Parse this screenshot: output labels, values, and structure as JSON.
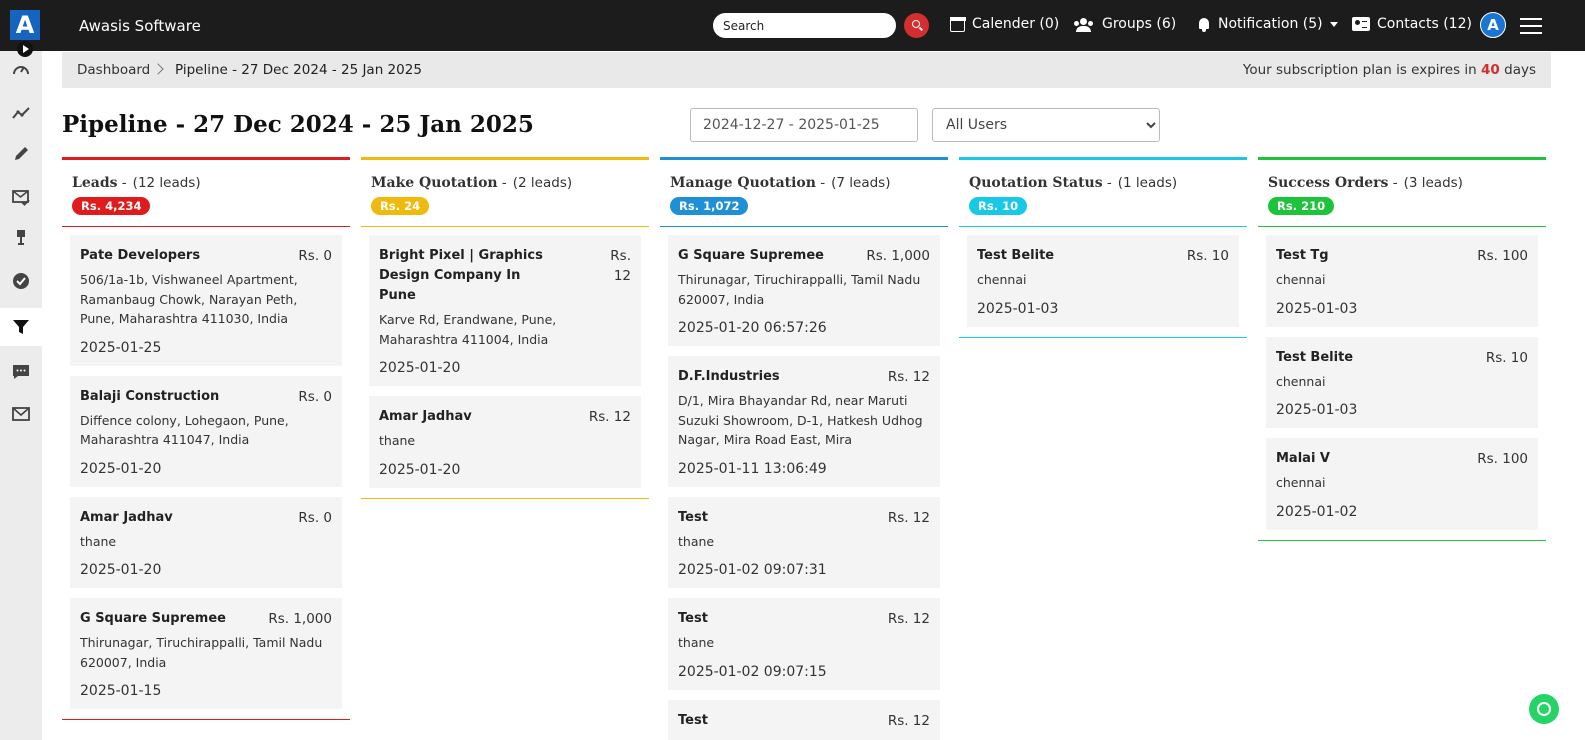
{
  "app": {
    "logo_letter": "A",
    "brand": "Awasis Software"
  },
  "search": {
    "placeholder": "Search"
  },
  "nav": {
    "calendar": "Calender (0)",
    "groups": "Groups (6)",
    "notification": "Notification (5)",
    "contacts": "Contacts (12)",
    "avatar_letter": "A"
  },
  "sidebar": {
    "items": [
      {
        "name": "dashboard",
        "icon": "speedometer-icon"
      },
      {
        "name": "analytics",
        "icon": "chart-line-icon"
      },
      {
        "name": "edit",
        "icon": "pencil-icon"
      },
      {
        "name": "mail-check",
        "icon": "mail-check-icon"
      },
      {
        "name": "award",
        "icon": "award-icon"
      },
      {
        "name": "tasks",
        "icon": "check-circle-icon"
      },
      {
        "name": "pipeline",
        "icon": "funnel-icon",
        "active": true
      },
      {
        "name": "chat",
        "icon": "chat-icon"
      },
      {
        "name": "mail",
        "icon": "envelope-icon"
      }
    ]
  },
  "breadcrumb": {
    "home": "Dashboard",
    "current": "Pipeline - 27 Dec 2024 - 25 Jan 2025"
  },
  "subscription": {
    "prefix": "Your subscription plan is expires in",
    "days": "40",
    "suffix": "days"
  },
  "page": {
    "title": "Pipeline - 27 Dec 2024 - 25 Jan 2025"
  },
  "filters": {
    "date_range": "2024-12-27 - 2025-01-25",
    "user": "All Users"
  },
  "columns": [
    {
      "title": "Leads",
      "count": "(12 leads)",
      "total": "Rs. 4,234",
      "color": "#e01b1b",
      "cards": [
        {
          "name": "Pate Developers",
          "amount": "Rs. 0",
          "address": "506/1a-1b, Vishwaneel Apartment, Ramanbaug Chowk, Narayan Peth, Pune, Maharashtra 411030, India",
          "date": "2025-01-25"
        },
        {
          "name": "Balaji Construction",
          "amount": "Rs. 0",
          "address": "Diffence colony, Lohegaon, Pune, Maharashtra 411047, India",
          "date": "2025-01-20"
        },
        {
          "name": "Amar Jadhav",
          "amount": "Rs. 0",
          "address": "thane",
          "date": "2025-01-20"
        },
        {
          "name": "G Square Supremee",
          "amount": "Rs. 1,000",
          "address": "Thirunagar, Tiruchirappalli, Tamil Nadu 620007, India",
          "date": "2025-01-15"
        }
      ]
    },
    {
      "title": "Make Quotation",
      "count": "(2 leads)",
      "total": "Rs. 24",
      "color": "#f0b90e",
      "cards": [
        {
          "name": "Bright Pixel | Graphics Design Company In Pune",
          "amount": "Rs. 12",
          "address": "Karve Rd, Erandwane, Pune, Maharashtra 411004, India",
          "date": "2025-01-20"
        },
        {
          "name": "Amar Jadhav",
          "amount": "Rs. 12",
          "address": "thane",
          "date": "2025-01-20"
        }
      ]
    },
    {
      "title": "Manage Quotation",
      "count": "(7 leads)",
      "total": "Rs. 1,072",
      "color": "#1f8fd6",
      "cards": [
        {
          "name": "G Square Supremee",
          "amount": "Rs. 1,000",
          "address": "Thirunagar, Tiruchirappalli, Tamil Nadu 620007, India",
          "date": "2025-01-20 06:57:26"
        },
        {
          "name": "D.F.Industries",
          "amount": "Rs. 12",
          "address": "D/1, Mira Bhayandar Rd, near Maruti Suzuki Showroom, D-1, Hatkesh Udhog Nagar, Mira Road East, Mira",
          "date": "2025-01-11 13:06:49"
        },
        {
          "name": "Test",
          "amount": "Rs. 12",
          "address": "thane",
          "date": "2025-01-02 09:07:31"
        },
        {
          "name": "Test",
          "amount": "Rs. 12",
          "address": "thane",
          "date": "2025-01-02 09:07:15"
        },
        {
          "name": "Test",
          "amount": "Rs. 12",
          "address": "",
          "date": ""
        }
      ]
    },
    {
      "title": "Quotation Status",
      "count": "(1 leads)",
      "total": "Rs. 10",
      "color": "#17c9e6",
      "cards": [
        {
          "name": "Test Belite",
          "amount": "Rs. 10",
          "address": "chennai",
          "date": "2025-01-03"
        }
      ]
    },
    {
      "title": "Success Orders",
      "count": "(3 leads)",
      "total": "Rs. 210",
      "color": "#1ec33c",
      "cards": [
        {
          "name": "Test Tg",
          "amount": "Rs. 100",
          "address": "chennai",
          "date": "2025-01-03"
        },
        {
          "name": "Test Belite",
          "amount": "Rs. 10",
          "address": "chennai",
          "date": "2025-01-03"
        },
        {
          "name": "Malai V",
          "amount": "Rs. 100",
          "address": "chennai",
          "date": "2025-01-02"
        }
      ]
    }
  ]
}
